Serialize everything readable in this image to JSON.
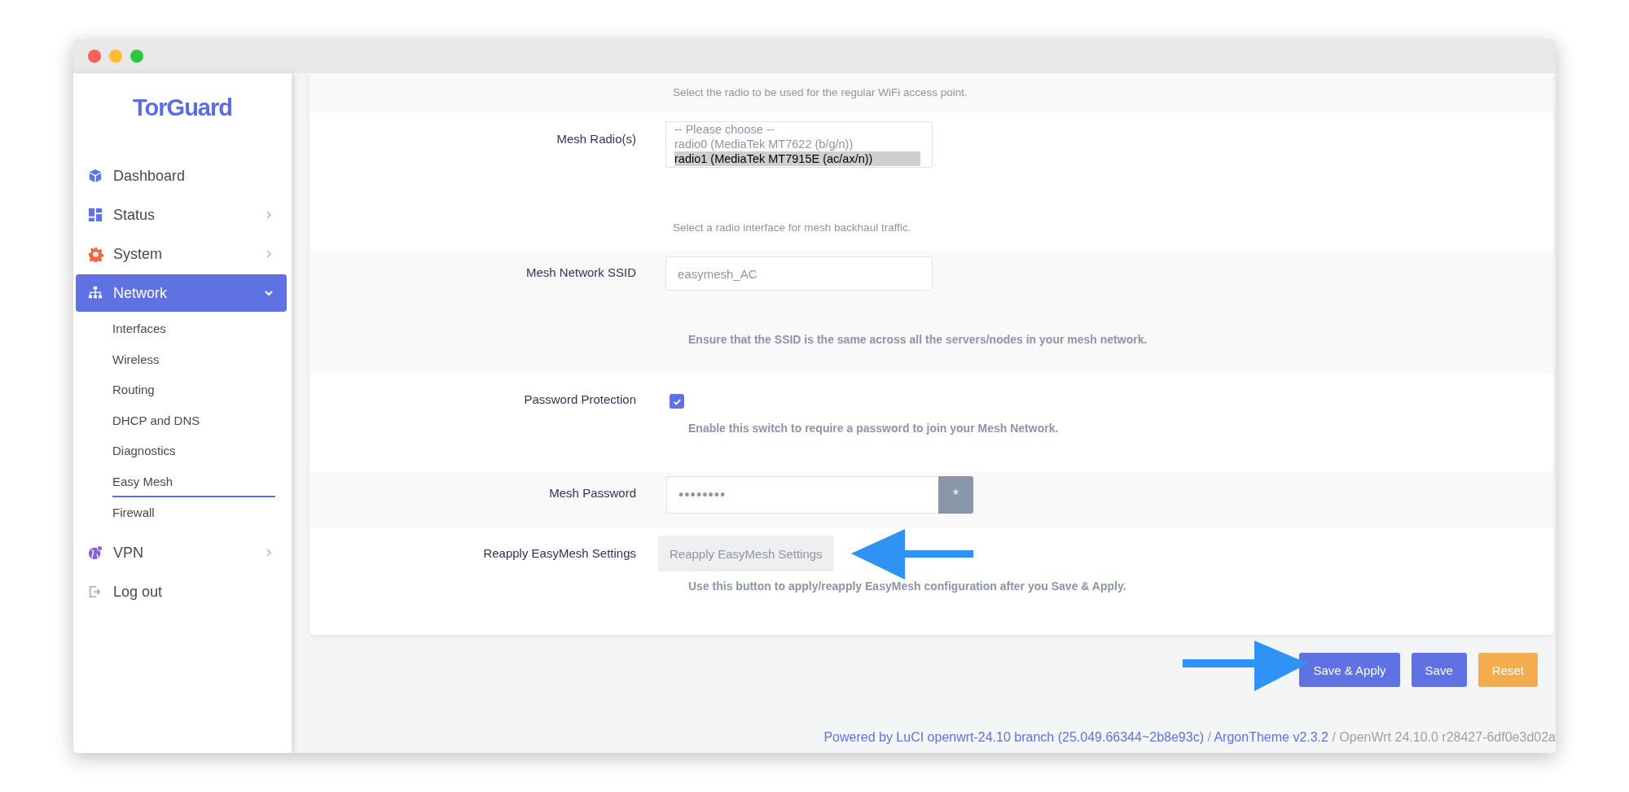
{
  "window": {
    "controls": [
      {
        "color": "#fe5f57"
      },
      {
        "color": "#febc2e"
      },
      {
        "color": "#28c840"
      }
    ]
  },
  "sidebar": {
    "logo": "TorGuard",
    "items": [
      {
        "label": "Dashboard",
        "kind": "link",
        "selected": false
      },
      {
        "label": "Status",
        "kind": "group",
        "expanded": false,
        "selected": false
      },
      {
        "label": "System",
        "kind": "group",
        "expanded": false,
        "selected": false
      },
      {
        "label": "Network",
        "kind": "group",
        "expanded": true,
        "selected": true,
        "children": [
          {
            "label": "Interfaces",
            "selected": false
          },
          {
            "label": "Wireless",
            "selected": false
          },
          {
            "label": "Routing",
            "selected": false
          },
          {
            "label": "DHCP and DNS",
            "selected": false
          },
          {
            "label": "Diagnostics",
            "selected": false
          },
          {
            "label": "Easy Mesh",
            "selected": true
          },
          {
            "label": "Firewall",
            "selected": false
          }
        ]
      },
      {
        "label": "VPN",
        "kind": "group",
        "expanded": false,
        "selected": false
      },
      {
        "label": "Log out",
        "kind": "link",
        "selected": false
      }
    ]
  },
  "form": {
    "top_hint": "Select the radio to be used for the regular WiFi access point.",
    "fields": [
      {
        "kind": "listbox",
        "label": "Mesh Radio(s)",
        "options": [
          {
            "label": "-- Please choose --",
            "selected": false
          },
          {
            "label": "radio0 (MediaTek MT7622 (b/g/n))",
            "selected": false
          },
          {
            "label": "radio1 (MediaTek MT7915E (ac/ax/n))",
            "selected": true
          }
        ],
        "help": "Select a radio interface for mesh backhaul traffic."
      },
      {
        "kind": "text",
        "label": "Mesh Network SSID",
        "value": "easymesh_AC",
        "help": "Ensure that the SSID is the same across all the servers/nodes in your mesh network."
      },
      {
        "kind": "checkbox",
        "label": "Password Protection",
        "checked": true,
        "help": "Enable this switch to require a password to join your Mesh Network."
      },
      {
        "kind": "password",
        "label": "Mesh Password",
        "value": "••••••••",
        "reveal": "*"
      },
      {
        "kind": "button",
        "label": "Reapply EasyMesh Settings",
        "button": "Reapply EasyMesh Settings",
        "help": "Use this button to apply/reapply EasyMesh configuration after you Save & Apply."
      }
    ]
  },
  "actions": [
    {
      "label": "Save & Apply",
      "kind": "primary"
    },
    {
      "label": "Save",
      "kind": "primary"
    },
    {
      "label": "Reset",
      "kind": "warning"
    }
  ],
  "footer": [
    {
      "text": "Powered by LuCI openwrt-24.10 branch (25.049.66344~2b8e93c)",
      "kind": "link"
    },
    {
      "text": "/",
      "kind": "text"
    },
    {
      "text": "ArgonTheme v2.3.2",
      "kind": "link"
    },
    {
      "text": "/ OpenWrt 24.10.0 r28427-6df0e3d02a",
      "kind": "text"
    }
  ]
}
